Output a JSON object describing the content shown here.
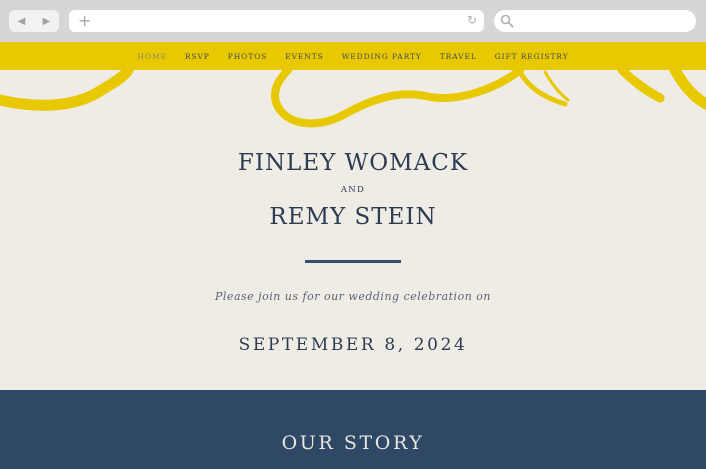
{
  "browser": {
    "back_icon": "◀",
    "forward_icon": "▶",
    "new_tab_icon": "+",
    "reload_icon": "↻"
  },
  "nav": {
    "items": [
      {
        "label": "HOME",
        "active": true
      },
      {
        "label": "RSVP",
        "active": false
      },
      {
        "label": "PHOTOS",
        "active": false
      },
      {
        "label": "EVENTS",
        "active": false
      },
      {
        "label": "WEDDING PARTY",
        "active": false
      },
      {
        "label": "TRAVEL",
        "active": false
      },
      {
        "label": "GIFT REGISTRY",
        "active": false
      }
    ]
  },
  "hero": {
    "name1": "FINLEY WOMACK",
    "and": "AND",
    "name2": "REMY STEIN",
    "invite": "Please join us for our wedding celebration on",
    "date": "SEPTEMBER 8, 2024"
  },
  "story": {
    "title": "OUR STORY"
  },
  "colors": {
    "nav_bg": "#e8c800",
    "brush": "#e8c800",
    "page_bg": "#efece6",
    "text": "#2d3c52",
    "story_bg": "#2e4866"
  }
}
